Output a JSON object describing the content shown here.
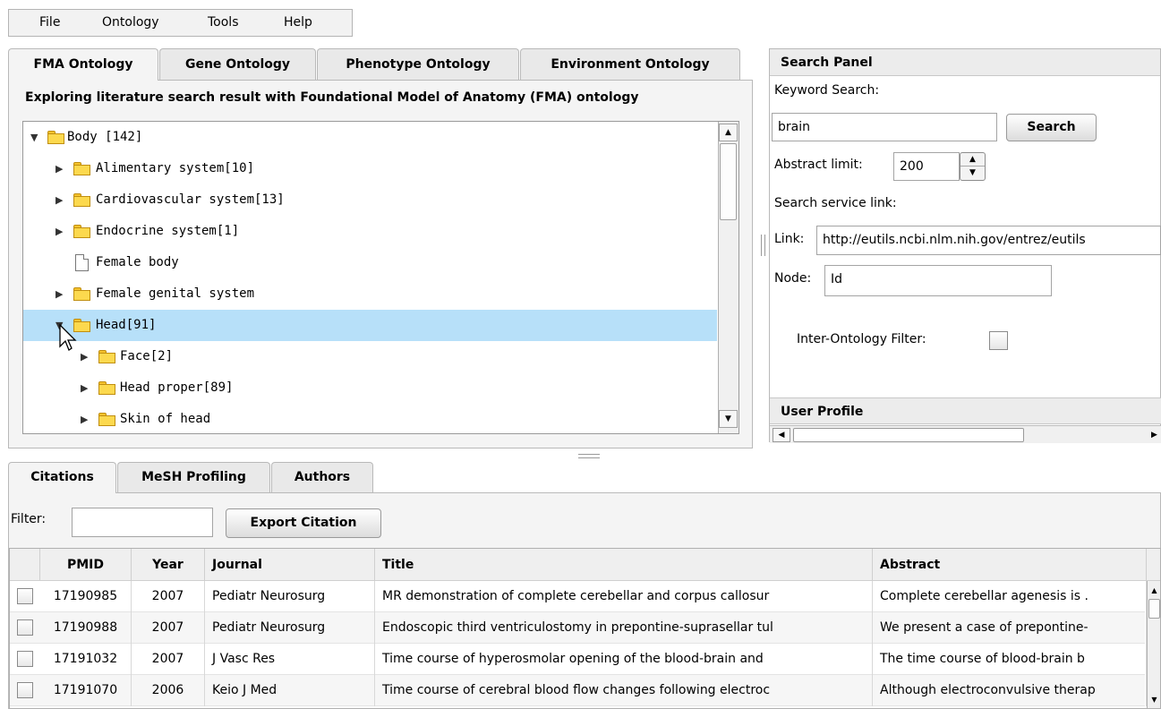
{
  "menu": [
    "File",
    "Ontology",
    "Tools",
    "Help"
  ],
  "ontology_tabs": [
    "FMA Ontology",
    "Gene Ontology",
    "Phenotype Ontology",
    "Environment Ontology"
  ],
  "ontology_heading": "Exploring literature search result with Foundational Model of Anatomy (FMA) ontology",
  "tree": [
    {
      "label": "Body [142]",
      "expanded": true,
      "icon": "open-folder-icon"
    },
    {
      "label": "Alimentary system[10]",
      "icon": "folder-icon"
    },
    {
      "label": "Cardiovascular system[13]",
      "icon": "folder-icon"
    },
    {
      "label": "Endocrine system[1]",
      "icon": "folder-icon"
    },
    {
      "label": "Female body",
      "icon": "document-icon"
    },
    {
      "label": "Female genital system",
      "icon": "folder-icon"
    },
    {
      "label": "Head[91]",
      "expanded": true,
      "selected": true,
      "icon": "open-folder-icon"
    },
    {
      "label": "Face[2]",
      "icon": "folder-icon"
    },
    {
      "label": "Head proper[89]",
      "icon": "folder-icon"
    },
    {
      "label": "Skin of head",
      "icon": "folder-icon"
    }
  ],
  "search_panel": {
    "title": "Search Panel",
    "keyword_label": "Keyword Search:",
    "keyword_value": "brain",
    "search_button": "Search",
    "abstract_limit_label": "Abstract limit:",
    "abstract_limit_value": "200",
    "service_link_label": "Search service link:",
    "link_label": "Link:",
    "link_value": "http://eutils.ncbi.nlm.nih.gov/entrez/eutils",
    "node_label": "Node:",
    "node_value": "Id",
    "filter_label": "Inter-Ontology Filter:",
    "user_profile": "User Profile"
  },
  "bottom_tabs": [
    "Citations",
    "MeSH Profiling",
    "Authors"
  ],
  "filter_label": "Filter:",
  "filter_value": "",
  "export_button": "Export Citation",
  "table": {
    "headers": [
      "PMID",
      "Year",
      "Journal",
      "Title",
      "Abstract"
    ],
    "rows": [
      [
        "17190985",
        "2007",
        "Pediatr Neurosurg",
        "MR demonstration of complete cerebellar and corpus callosur",
        "Complete cerebellar agenesis is ."
      ],
      [
        "17190988",
        "2007",
        "Pediatr Neurosurg",
        "Endoscopic third ventriculostomy in prepontine-suprasellar tul",
        "We present a case of prepontine-"
      ],
      [
        "17191032",
        "2007",
        "J Vasc Res",
        "Time course of hyperosmolar opening of the blood-brain and",
        "The time course of blood-brain b"
      ],
      [
        "17191070",
        "2006",
        "Keio J Med",
        "Time course of cerebral blood flow changes following electroc",
        "Although electroconvulsive therap"
      ]
    ]
  },
  "colors": {
    "selection": "#b7e0f9",
    "folder": "#fcd94e"
  }
}
